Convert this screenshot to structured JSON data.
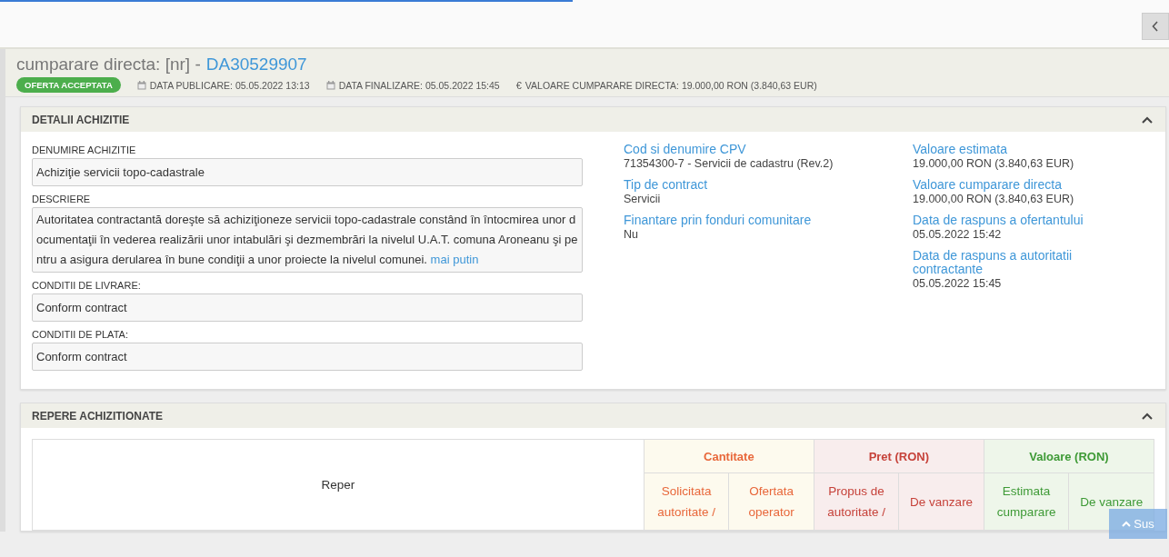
{
  "loading_bar": {
    "level": 0.49
  },
  "header": {
    "title": "cumparare directa: [nr] -",
    "number": "DA30529907",
    "status": "OFERTA ACCEPTATA",
    "meta": [
      {
        "kind": "date",
        "text": "DATA PUBLICARE: 05.05.2022 13:13"
      },
      {
        "kind": "date",
        "text": "DATA FINALIZARE: 05.05.2022 15:45"
      },
      {
        "kind": "money",
        "icon": "€",
        "text": "VALOARE CUMPARARE DIRECTA: 19.000,00  RON (3.840,63  EUR)"
      }
    ]
  },
  "details": {
    "title": "DETALII ACHIZITIE",
    "fields": [
      {
        "label": "DENUMIRE ACHIZITIE",
        "value": "Achiziţie servicii topo-cadastrale"
      },
      {
        "label": "DESCRIERE",
        "value": "Autoritatea contractantă doreşte să achiziţioneze servicii topo-cadastrale constând în întocmirea unor documentaţii în vederea realizării unor intabulări şi dezmembrări la nivelul U.A.T. comuna Aroneanu şi pentru a asigura derularea în bune condiţii a unor proiecte la nivelul comunei.",
        "link": "mai putin"
      },
      {
        "label": "CONDITII DE LIVRARE:",
        "value": "Conform contract"
      },
      {
        "label": "CONDITII DE PLATA:",
        "value": "Conform contract"
      }
    ],
    "info_columns": [
      [
        {
          "label": "Cod si denumire CPV",
          "value": "71354300-7 - Servicii de cadastru (Rev.2)"
        },
        {
          "label": "Tip de contract",
          "value": "Servicii"
        },
        {
          "label": "Finantare prin fonduri comunitare",
          "value": "Nu"
        }
      ],
      [
        {
          "label": "Valoare estimata",
          "value": "19.000,00  RON (3.840,63  EUR)"
        },
        {
          "label": "Valoare cumparare directa",
          "value": "19.000,00  RON (3.840,63  EUR)"
        },
        {
          "label": "Data de raspuns a ofertantului",
          "value": "05.05.2022 15:42"
        },
        {
          "label": "Data de raspuns a autoritatii contractante",
          "value": "05.05.2022 15:45"
        }
      ]
    ]
  },
  "items": {
    "title": "REPERE ACHIZITIONATE",
    "first_column": "Reper",
    "groups": [
      {
        "kind": "quantity",
        "label": "Cantitate",
        "columns": [
          "Solicitata autoritate /",
          "Ofertata operator"
        ]
      },
      {
        "kind": "price",
        "label": "Pret (RON)",
        "columns": [
          "Propus de autoritate /",
          "De vanzare"
        ]
      },
      {
        "kind": "value",
        "label": "Valoare (RON)",
        "columns": [
          "Estimata cumparare",
          "De vanzare"
        ]
      }
    ]
  },
  "scroll_top_button": "Sus"
}
